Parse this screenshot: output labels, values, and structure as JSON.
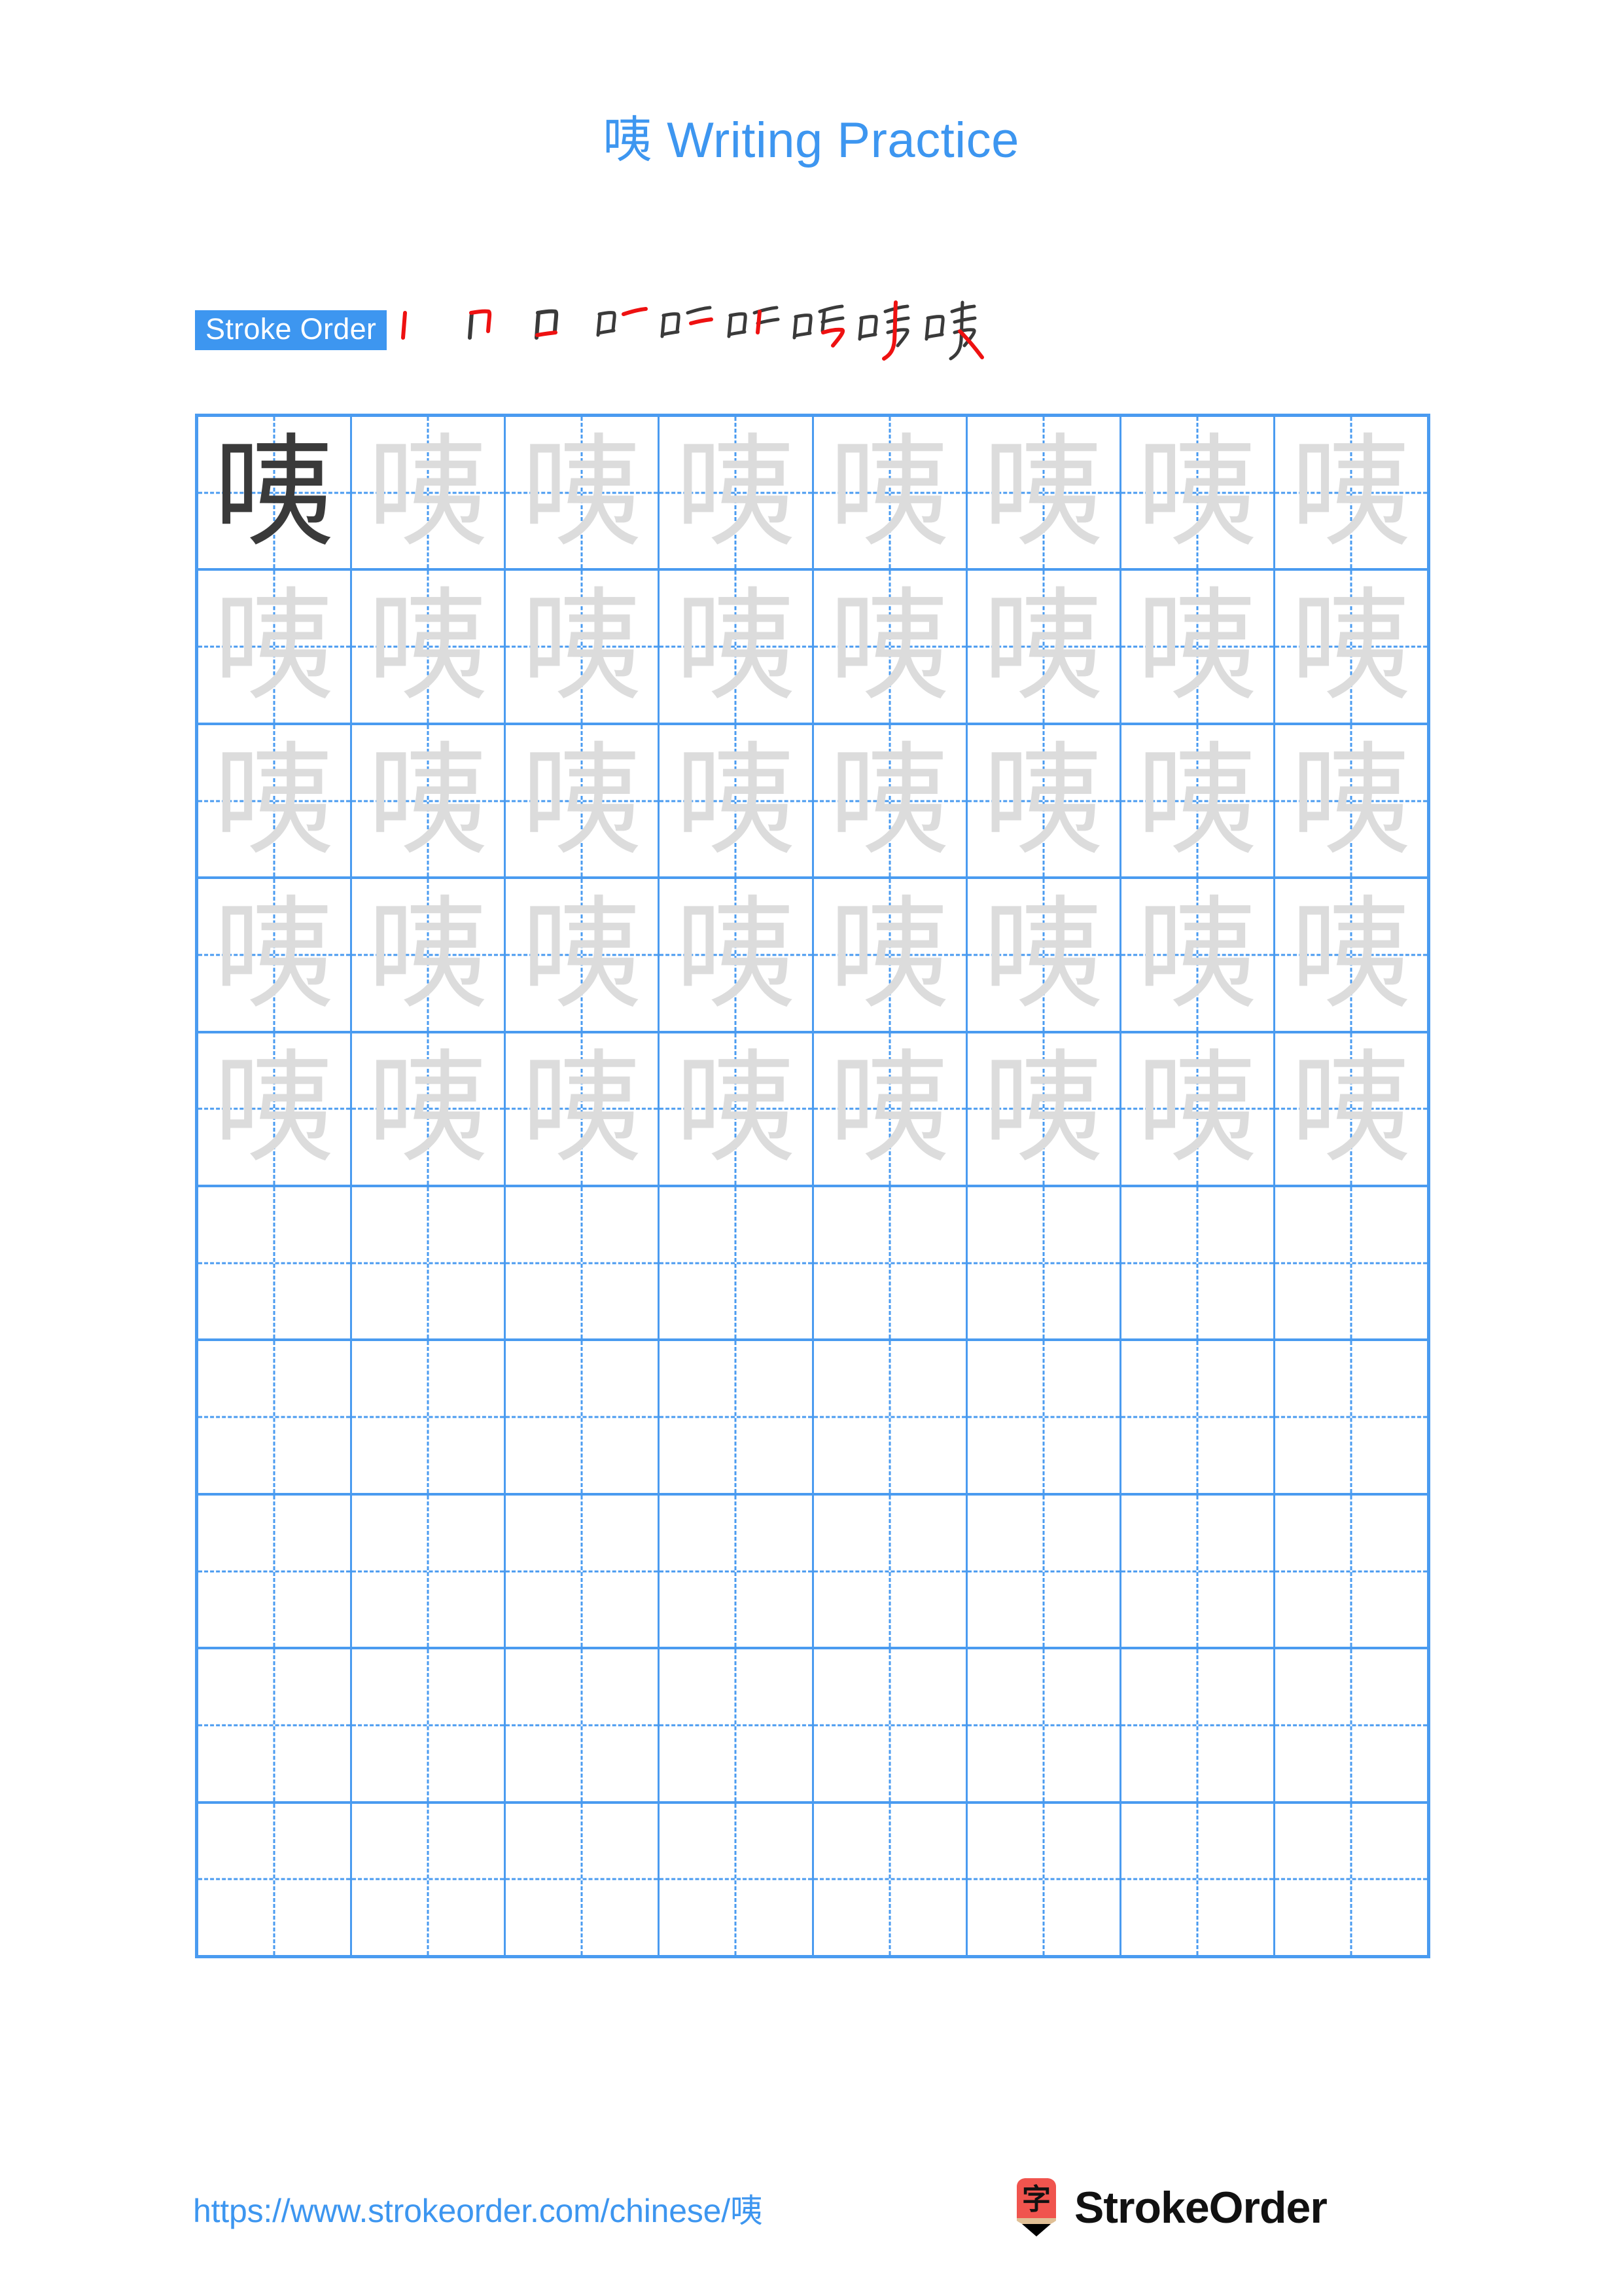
{
  "document": {
    "character": "咦",
    "title": "咦 Writing Practice",
    "title_character": "咦",
    "title_suffix": " Writing Practice"
  },
  "stroke_order": {
    "badge_label": "Stroke Order",
    "badge_bg_color": "#3d96f0",
    "badge_text_color": "#ffffff",
    "stroke_count": 9,
    "new_stroke_color": "#ee1111",
    "prior_stroke_color": "#3a3a3a",
    "steps": [
      {
        "index": 1,
        "name": "stroke-1"
      },
      {
        "index": 2,
        "name": "stroke-2"
      },
      {
        "index": 3,
        "name": "stroke-3"
      },
      {
        "index": 4,
        "name": "stroke-4"
      },
      {
        "index": 5,
        "name": "stroke-5"
      },
      {
        "index": 6,
        "name": "stroke-6"
      },
      {
        "index": 7,
        "name": "stroke-7"
      },
      {
        "index": 8,
        "name": "stroke-8"
      },
      {
        "index": 9,
        "name": "stroke-9"
      }
    ]
  },
  "practice_grid": {
    "columns": 8,
    "rows": 10,
    "grid_line_color": "#4a9bf0",
    "model_glyph_color": "#3a3a3a",
    "trace_glyph_color": "#dcdcdc",
    "glyph": "咦",
    "row_fill": [
      {
        "row": 1,
        "cells": [
          "model",
          "trace",
          "trace",
          "trace",
          "trace",
          "trace",
          "trace",
          "trace"
        ]
      },
      {
        "row": 2,
        "cells": [
          "trace",
          "trace",
          "trace",
          "trace",
          "trace",
          "trace",
          "trace",
          "trace"
        ]
      },
      {
        "row": 3,
        "cells": [
          "trace",
          "trace",
          "trace",
          "trace",
          "trace",
          "trace",
          "trace",
          "trace"
        ]
      },
      {
        "row": 4,
        "cells": [
          "trace",
          "trace",
          "trace",
          "trace",
          "trace",
          "trace",
          "trace",
          "trace"
        ]
      },
      {
        "row": 5,
        "cells": [
          "trace",
          "trace",
          "trace",
          "trace",
          "trace",
          "trace",
          "trace",
          "trace"
        ]
      },
      {
        "row": 6,
        "cells": [
          "empty",
          "empty",
          "empty",
          "empty",
          "empty",
          "empty",
          "empty",
          "empty"
        ]
      },
      {
        "row": 7,
        "cells": [
          "empty",
          "empty",
          "empty",
          "empty",
          "empty",
          "empty",
          "empty",
          "empty"
        ]
      },
      {
        "row": 8,
        "cells": [
          "empty",
          "empty",
          "empty",
          "empty",
          "empty",
          "empty",
          "empty",
          "empty"
        ]
      },
      {
        "row": 9,
        "cells": [
          "empty",
          "empty",
          "empty",
          "empty",
          "empty",
          "empty",
          "empty",
          "empty"
        ]
      },
      {
        "row": 10,
        "cells": [
          "empty",
          "empty",
          "empty",
          "empty",
          "empty",
          "empty",
          "empty",
          "empty"
        ]
      }
    ]
  },
  "footer": {
    "url_text": "https://www.strokeorder.com/chinese/咦",
    "url_prefix": "https://www.strokeorder.com/chinese/",
    "url_character": "咦",
    "url_color": "#3d96f0",
    "brand_name": "StrokeOrder",
    "logo_character": "字",
    "logo_body_color": "#f0544e",
    "logo_wood_color": "#e0bf95",
    "logo_tip_color": "#000000"
  }
}
